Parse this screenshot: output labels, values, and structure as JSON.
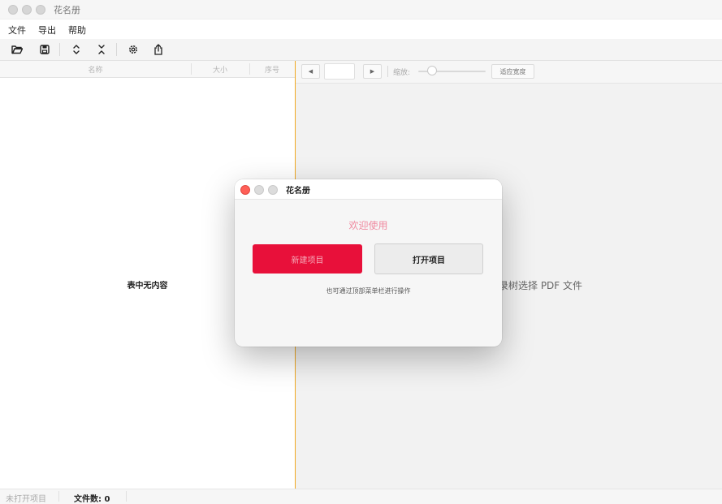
{
  "window": {
    "title": "花名册"
  },
  "menu": {
    "items": [
      "文件",
      "导出",
      "帮助"
    ]
  },
  "toolbar": {
    "icons": [
      "folder-open-icon",
      "save-icon",
      "expand-icon",
      "collapse-icon",
      "settings-icon",
      "share-icon"
    ]
  },
  "table": {
    "columns": [
      "名称",
      "大小",
      "序号"
    ],
    "empty_text": "表中无内容"
  },
  "pdf_viewer": {
    "prev_symbol": "◀",
    "next_symbol": "▶",
    "page_value": "",
    "zoom_label": "缩放:",
    "zoom_level": 0.15,
    "fit_width_label": "适应宽度",
    "hint_visible": "录树选择 PDF 文件"
  },
  "status": {
    "project": "未打开项目",
    "file_count": "文件数: 0"
  },
  "dialog": {
    "title": "花名册",
    "welcome": "欢迎使用",
    "new_project": "新建项目",
    "open_project": "打开项目",
    "hint": "也可通过顶部菜单栏进行操作"
  },
  "colors": {
    "accent_red": "#e8103a",
    "divider_orange": "#f0a821",
    "close_red": "#ff5f57"
  }
}
